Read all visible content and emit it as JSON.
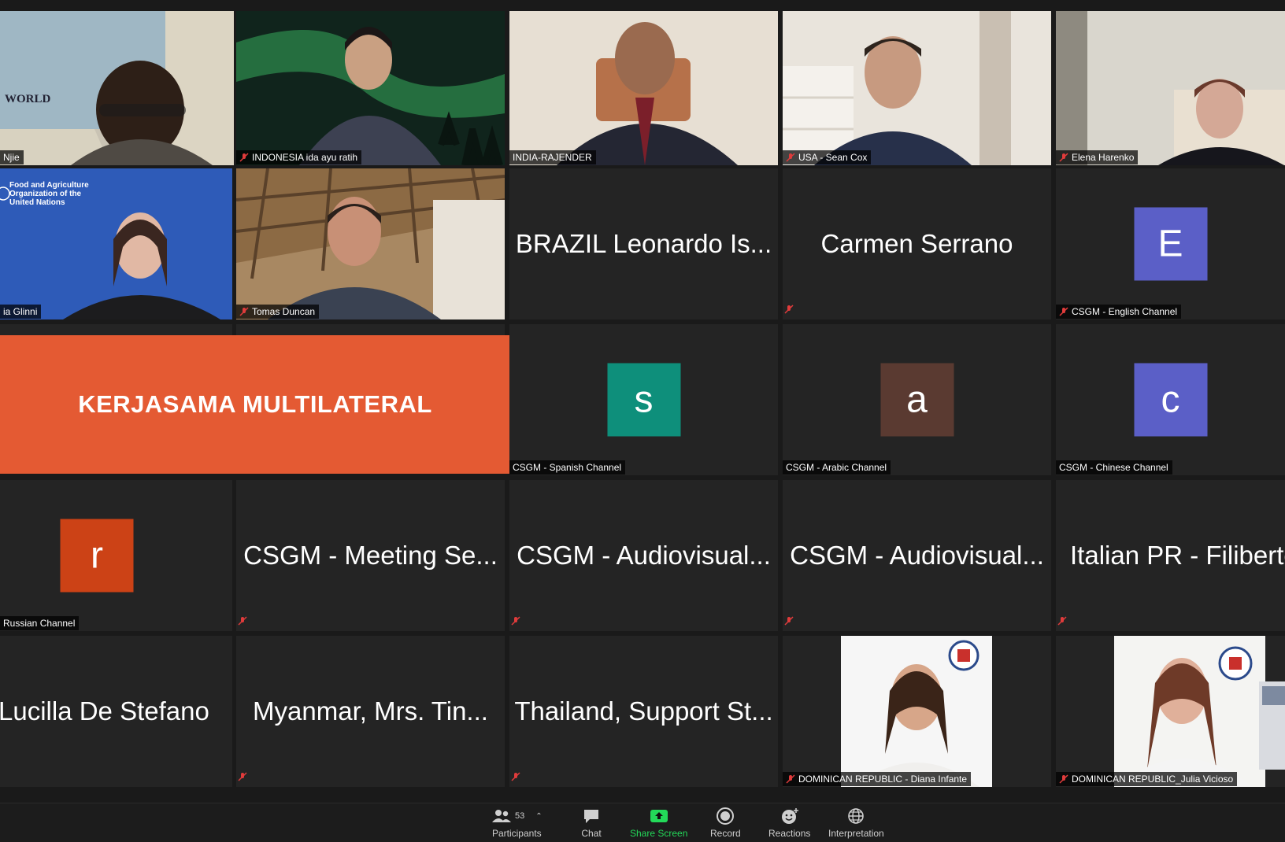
{
  "gallery": {
    "row1": [
      "Njie",
      "INDONESIA ida ayu ratih",
      "INDIA-RAJENDER",
      "USA - Sean Cox",
      "Elena Harenko"
    ],
    "row2": {
      "glinni": "ia Glinni",
      "tomas": "Tomas Duncan",
      "brazil": "BRAZIL Leonardo Is...",
      "carmen": "Carmen Serrano",
      "english_letter": "E",
      "english_label": "CSGM - English Channel",
      "fao_text": "Food and Agriculture Organization of the United Nations"
    },
    "banner": "KERJASAMA MULTILATERAL",
    "row3": {
      "spanish_letter": "s",
      "spanish_label": "CSGM - Spanish Channel",
      "arabic_letter": "a",
      "arabic_label": "CSGM - Arabic Channel",
      "chinese_letter": "c",
      "chinese_label": "CSGM - Chinese Channel"
    },
    "row4": {
      "russian_letter": "r",
      "russian_label": "Russian Channel",
      "meeting": "CSGM - Meeting Se...",
      "audio1": "CSGM - Audiovisual...",
      "audio2": "CSGM - Audiovisual...",
      "italian": "Italian PR - Filiberto"
    },
    "row5": {
      "lucilla": "Lucilla De Stefano",
      "myanmar": "Myanmar, Mrs. Tin...",
      "thailand": "Thailand, Support St...",
      "diana": "DOMINICAN REPUBLIC - Diana Infante",
      "julia": "DOMINICAN REPUBLIC_Julia Vicioso"
    },
    "world_map_text": "WORLD"
  },
  "colors": {
    "spanish": "#0e8f7b",
    "arabic": "#5a3a31",
    "chinese": "#5b5fc7",
    "english": "#5b5fc7",
    "russian": "#cc4216",
    "banner": "#e45a33",
    "speaker_border": "#d7e35a"
  },
  "toolbar": {
    "participants_count": "53",
    "participants": "Participants",
    "chat": "Chat",
    "share": "Share Screen",
    "record": "Record",
    "reactions": "Reactions",
    "interpretation": "Interpretation"
  }
}
